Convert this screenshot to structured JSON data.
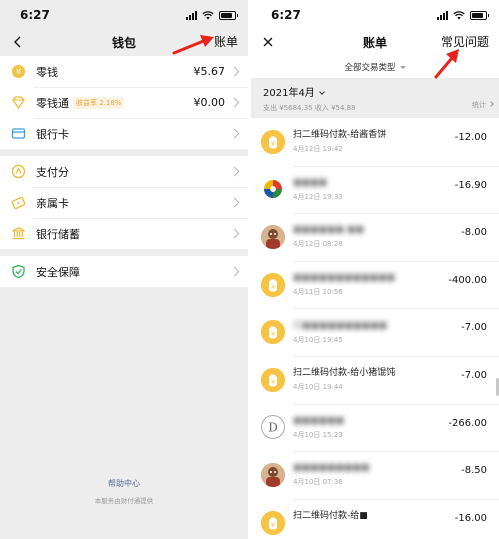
{
  "left": {
    "status_time": "6:27",
    "title": "钱包",
    "right_action": "账单",
    "groups": [
      [
        {
          "label": "零钱",
          "value": "¥5.67",
          "badge": "",
          "icon": "coin-icon"
        },
        {
          "label": "零钱通",
          "value": "¥0.00",
          "badge": "收益率 2.18%",
          "icon": "diamond-icon"
        },
        {
          "label": "银行卡",
          "value": "",
          "badge": "",
          "icon": "bank-card-icon"
        }
      ],
      [
        {
          "label": "支付分",
          "value": "",
          "badge": "",
          "icon": "score-icon"
        },
        {
          "label": "亲属卡",
          "value": "",
          "badge": "",
          "icon": "family-card-icon"
        },
        {
          "label": "银行储蓄",
          "value": "",
          "badge": "",
          "icon": "bank-building-icon"
        }
      ],
      [
        {
          "label": "安全保障",
          "value": "",
          "badge": "",
          "icon": "shield-icon"
        }
      ]
    ],
    "footer_link": "帮助中心",
    "footer_note": "本服务由财付通提供"
  },
  "right": {
    "status_time": "6:27",
    "title": "账单",
    "right_action": "常见问题",
    "filter_label": "全部交易类型",
    "month": "2021年4月",
    "summary": "支出 ¥5684.35  收入 ¥54.88",
    "stats_label": "统计",
    "transactions": [
      {
        "title": "扫二维码付款-给酱香饼",
        "time": "4月12日 19:42",
        "amount": "-12.00",
        "avatar": "coin",
        "blurred": false
      },
      {
        "title": "■■■■",
        "time": "4月12日 19:33",
        "amount": "-16.90",
        "avatar": "swirl",
        "blurred": true
      },
      {
        "title": "■■■■■■ ■■",
        "time": "4月12日 08:28",
        "amount": "-8.00",
        "avatar": "photo",
        "blurred": true
      },
      {
        "title": "■■■■■■■■■■■■",
        "time": "4月11日 10:56",
        "amount": "-400.00",
        "avatar": "coin",
        "blurred": true
      },
      {
        "title": "扫■■■■■■■■■■",
        "time": "4月10日 19:45",
        "amount": "-7.00",
        "avatar": "coin",
        "blurred": true
      },
      {
        "title": "扫二维码付款-给小猪馄饨",
        "time": "4月10日 19:44",
        "amount": "-7.00",
        "avatar": "coin",
        "blurred": false
      },
      {
        "title": "■■■■■■",
        "time": "4月10日 15:23",
        "amount": "-266.00",
        "avatar": "letter",
        "blurred": true
      },
      {
        "title": "■■■■■■■■■",
        "time": "4月10日 07:36",
        "amount": "-8.50",
        "avatar": "photo",
        "blurred": true
      },
      {
        "title": "扫二维码付款-给■",
        "time": "",
        "amount": "-16.00",
        "avatar": "coin",
        "blurred": false
      }
    ]
  }
}
